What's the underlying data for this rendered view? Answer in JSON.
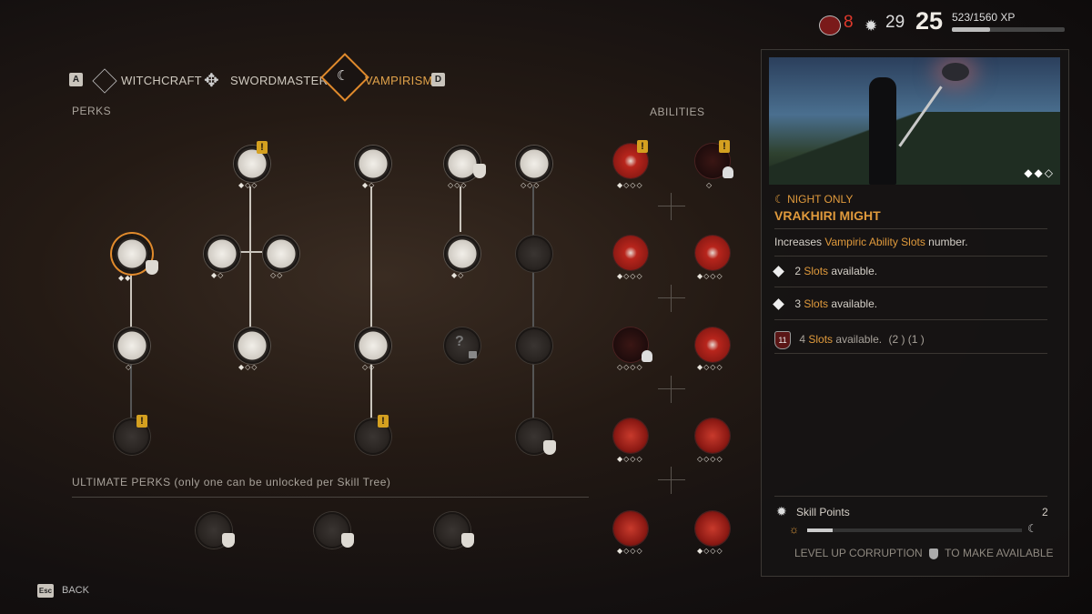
{
  "top": {
    "corruption": "8",
    "skill_points": "29",
    "level": "25",
    "xp": "523/1560 XP",
    "xp_fraction": 0.335
  },
  "tabs": {
    "key_left": "A",
    "witchcraft": "WITCHCRAFT",
    "swordmastery": "SWORDMASTERY",
    "vampirism": "VAMPIRISM",
    "key_right": "D"
  },
  "sections": {
    "perks": "PERKS",
    "abilities": "ABILITIES",
    "ultimate": "ULTIMATE PERKS (only one can be unlocked per Skill Tree)"
  },
  "panel": {
    "condition": "NIGHT ONLY",
    "title": "VRAKHIRI MIGHT",
    "desc_pre": "Increases ",
    "desc_gold": "Vampiric Ability Slots",
    "desc_post": " number.",
    "ranks": [
      {
        "num": "2",
        "word": "Slots",
        "rest": " available."
      },
      {
        "num": "3",
        "word": "Slots",
        "rest": " available."
      },
      {
        "num": "4",
        "word": "Slots",
        "rest": " available.",
        "cost": "(2 ) (1 )",
        "badge": "11"
      }
    ],
    "skill_points_label": "Skill Points",
    "skill_points_value": "2",
    "level_up_pre": "LEVEL UP CORRUPTION",
    "level_up_post": "TO MAKE AVAILABLE"
  },
  "footer": {
    "esc": "Esc",
    "back": "BACK"
  }
}
